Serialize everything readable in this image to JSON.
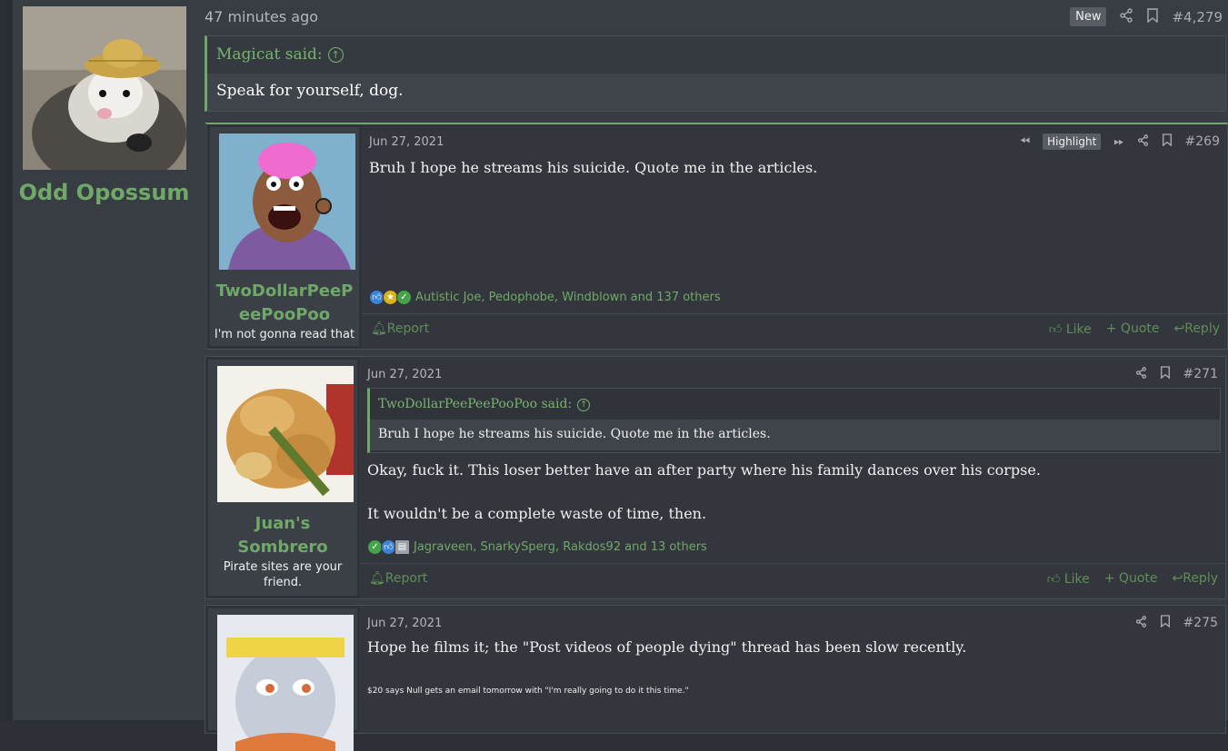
{
  "author": {
    "name": "Odd Opossum",
    "avatar_icon": "opossum-with-straw-hat-avatar"
  },
  "post": {
    "time": "47 minutes ago",
    "new_badge": "New",
    "number": "#4,279",
    "quote": {
      "author_said": "Magicat said:",
      "text": "Speak for yourself, dog."
    }
  },
  "embeds": [
    {
      "username_line1": "TwoDollarPeeP",
      "username_line2": "eePooPoo",
      "user_title": "I'm not gonna read that",
      "avatar_icon": "cartoon-pink-hair-character-avatar",
      "date": "Jun 27, 2021",
      "highlight": "Highlight",
      "number": "#269",
      "text": "Bruh I hope he streams his suicide. Quote me in the articles.",
      "reactions": "Autistic Joe, Pedophobe, Windblown and 137 others",
      "report": "Report",
      "like": "Like",
      "quote": "Quote",
      "reply": "Reply"
    },
    {
      "username_line1": "Juan's",
      "username_line2": "Sombrero",
      "user_title_line1": "Pirate sites are your",
      "user_title_line2": "friend.",
      "avatar_icon": "fried-tempura-avatar",
      "date": "Jun 27, 2021",
      "number": "#271",
      "quote_author": "TwoDollarPeePeePooPoo said:",
      "quote_text": "Bruh I hope he streams his suicide. Quote me in the articles.",
      "text1": "Okay, fuck it. This loser better have an after party where his family dances over his corpse.",
      "text2": "It wouldn't be a complete waste of time, then.",
      "reactions": "Jagraveen, SnarkySperg, Rakdos92 and 13 others",
      "report": "Report",
      "like": "Like",
      "quote": "Quote",
      "reply": "Reply"
    },
    {
      "avatar_icon": "cartoon-goat-headband-avatar",
      "date": "Jun 27, 2021",
      "number": "#275",
      "text": "Hope he films it; the \"Post videos of people dying\" thread has been slow recently.",
      "small_text": "$20 says Null gets an email tomorrow with \"I'm really going to do it this time.\""
    }
  ],
  "colors": {
    "accent": "#6fa868",
    "background": "#383c43",
    "embed_bg": "#33363c"
  }
}
